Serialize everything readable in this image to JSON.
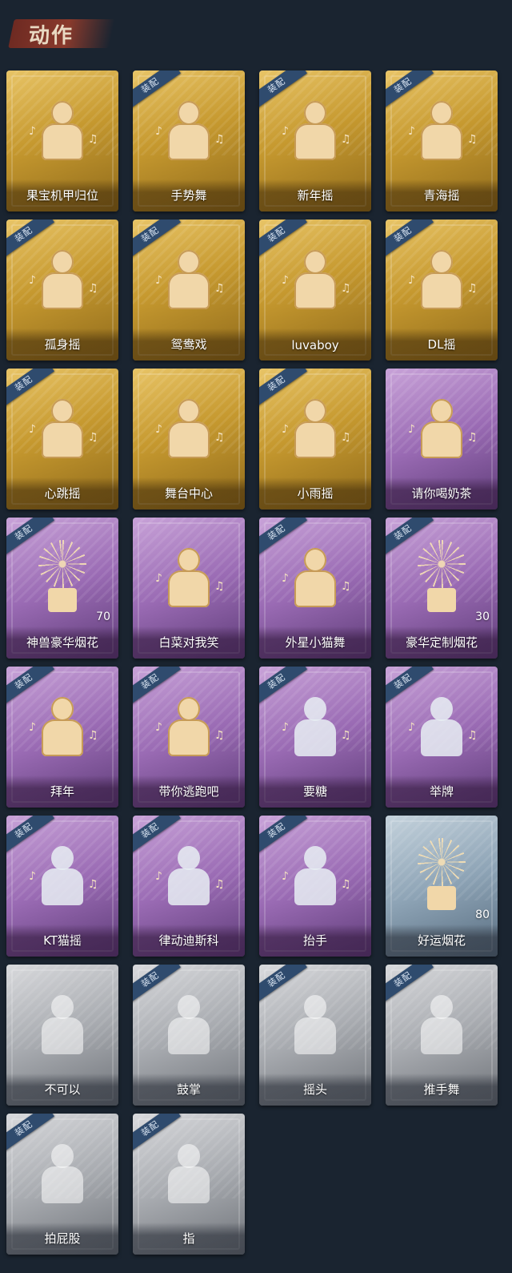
{
  "header": {
    "title": "动作"
  },
  "badge_text": "装配",
  "items": [
    {
      "name": "果宝机甲归位",
      "rarity": "gold",
      "equipped": false,
      "count": ""
    },
    {
      "name": "手势舞",
      "rarity": "gold",
      "equipped": true,
      "count": ""
    },
    {
      "name": "新年摇",
      "rarity": "gold",
      "equipped": true,
      "count": ""
    },
    {
      "name": "青海摇",
      "rarity": "gold",
      "equipped": true,
      "count": ""
    },
    {
      "name": "孤身摇",
      "rarity": "gold",
      "equipped": true,
      "count": ""
    },
    {
      "name": "鸳鸯戏",
      "rarity": "gold",
      "equipped": true,
      "count": ""
    },
    {
      "name": "luvaboy",
      "rarity": "gold",
      "equipped": true,
      "count": ""
    },
    {
      "name": "DL摇",
      "rarity": "gold",
      "equipped": true,
      "count": ""
    },
    {
      "name": "心跳摇",
      "rarity": "gold",
      "equipped": true,
      "count": ""
    },
    {
      "name": "舞台中心",
      "rarity": "gold",
      "equipped": false,
      "count": ""
    },
    {
      "name": "小雨摇",
      "rarity": "gold",
      "equipped": true,
      "count": ""
    },
    {
      "name": "请你喝奶茶",
      "rarity": "purple",
      "equipped": false,
      "count": ""
    },
    {
      "name": "神兽豪华烟花",
      "rarity": "purple",
      "equipped": true,
      "count": "70"
    },
    {
      "name": "白菜对我笑",
      "rarity": "purple",
      "equipped": false,
      "count": ""
    },
    {
      "name": "外星小猫舞",
      "rarity": "purple",
      "equipped": true,
      "count": ""
    },
    {
      "name": "豪华定制烟花",
      "rarity": "purple",
      "equipped": true,
      "count": "30"
    },
    {
      "name": "拜年",
      "rarity": "purple",
      "equipped": true,
      "count": ""
    },
    {
      "name": "带你逃跑吧",
      "rarity": "purple",
      "equipped": true,
      "count": ""
    },
    {
      "name": "要糖",
      "rarity": "purple",
      "equipped": true,
      "count": ""
    },
    {
      "name": "举牌",
      "rarity": "purple",
      "equipped": true,
      "count": ""
    },
    {
      "name": "KT猫摇",
      "rarity": "purple",
      "equipped": true,
      "count": ""
    },
    {
      "name": "律动迪斯科",
      "rarity": "purple",
      "equipped": true,
      "count": ""
    },
    {
      "name": "抬手",
      "rarity": "purple",
      "equipped": true,
      "count": ""
    },
    {
      "name": "好运烟花",
      "rarity": "blue",
      "equipped": false,
      "count": "80"
    },
    {
      "name": "不可以",
      "rarity": "gray",
      "equipped": false,
      "count": ""
    },
    {
      "name": "鼓掌",
      "rarity": "gray",
      "equipped": true,
      "count": ""
    },
    {
      "name": "摇头",
      "rarity": "gray",
      "equipped": true,
      "count": ""
    },
    {
      "name": "推手舞",
      "rarity": "gray",
      "equipped": true,
      "count": ""
    },
    {
      "name": "拍屁股",
      "rarity": "gray",
      "equipped": true,
      "count": ""
    },
    {
      "name": "指",
      "rarity": "gray",
      "equipped": true,
      "count": ""
    }
  ],
  "colors": {
    "background": "#1a2430",
    "gold": "#c6992f",
    "purple": "#9a6bb4",
    "blue": "#8ea4b6",
    "gray": "#a8abb0",
    "badge": "#2f4b6e",
    "title_brush": "#8a3a2c"
  }
}
